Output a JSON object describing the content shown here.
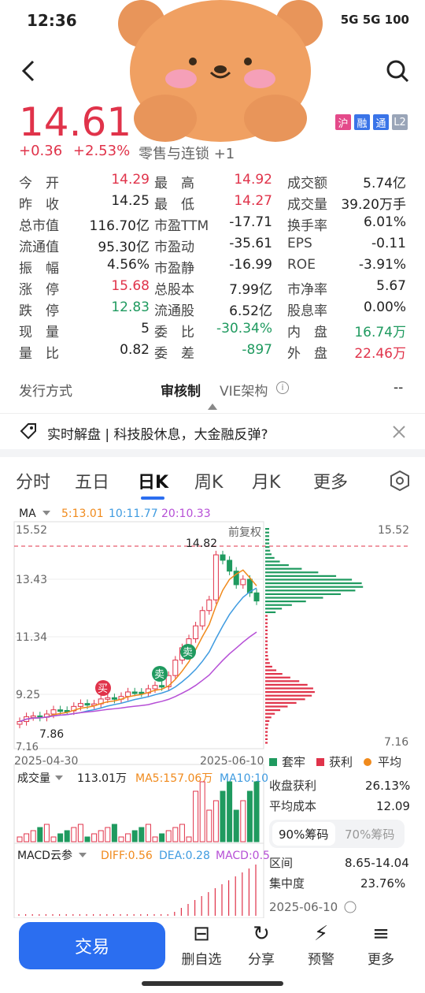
{
  "status_bar": {
    "time": "12:36",
    "signal": "5G 5G 100"
  },
  "header": {
    "back_icon": "chevron-left-icon",
    "search_icon": "search-icon"
  },
  "quote": {
    "price": "14.61",
    "change_abs": "+0.36",
    "change_pct": "+2.53%",
    "sector": "零售与连锁 +1",
    "badges": [
      {
        "label": "沪",
        "color": "#e44a8a"
      },
      {
        "label": "融",
        "color": "#3a74e8"
      },
      {
        "label": "通",
        "color": "#3a74e8"
      },
      {
        "label": "L2",
        "color": "#9aa5b8"
      }
    ]
  },
  "stats": [
    [
      {
        "label": "今　开",
        "value": "14.29",
        "color": "red"
      },
      {
        "label": "最　高",
        "value": "14.92",
        "color": "red"
      },
      {
        "label": "成交额",
        "value": "5.74亿",
        "color": "dark"
      }
    ],
    [
      {
        "label": "昨　收",
        "value": "14.25",
        "color": "dark"
      },
      {
        "label": "最　低",
        "value": "14.27",
        "color": "red"
      },
      {
        "label": "成交量",
        "value": "39.20万手",
        "color": "dark"
      }
    ],
    [
      {
        "label": "总市值",
        "value": "116.70亿",
        "color": "dark"
      },
      {
        "label": "市盈TTM",
        "value": "-17.71",
        "color": "dark"
      },
      {
        "label": "换手率",
        "value": "6.01%",
        "color": "dark"
      }
    ],
    [
      {
        "label": "流通值",
        "value": "95.30亿",
        "color": "dark"
      },
      {
        "label": "市盈动",
        "value": "-35.61",
        "color": "dark"
      },
      {
        "label": "EPS",
        "value": "-0.11",
        "color": "dark"
      }
    ],
    [
      {
        "label": "振　幅",
        "value": "4.56%",
        "color": "dark"
      },
      {
        "label": "市盈静",
        "value": "-16.99",
        "color": "dark"
      },
      {
        "label": "ROE",
        "value": "-3.91%",
        "color": "dark"
      }
    ],
    [
      {
        "label": "涨　停",
        "value": "15.68",
        "color": "red"
      },
      {
        "label": "总股本",
        "value": "7.99亿",
        "color": "dark"
      },
      {
        "label": "市净率",
        "value": "5.67",
        "color": "dark"
      }
    ],
    [
      {
        "label": "跌　停",
        "value": "12.83",
        "color": "green"
      },
      {
        "label": "流通股",
        "value": "6.52亿",
        "color": "dark"
      },
      {
        "label": "股息率",
        "value": "0.00%",
        "color": "dark"
      }
    ],
    [
      {
        "label": "现　量",
        "value": "5",
        "color": "dark"
      },
      {
        "label": "委　比",
        "value": "-30.34%",
        "color": "green"
      },
      {
        "label": "内　盘",
        "value": "16.74万",
        "color": "green"
      }
    ],
    [
      {
        "label": "量　比",
        "value": "0.82",
        "color": "dark"
      },
      {
        "label": "委　差",
        "value": "-897",
        "color": "green"
      },
      {
        "label": "外　盘",
        "value": "22.46万",
        "color": "red"
      }
    ]
  ],
  "issuance": {
    "label": "发行方式",
    "option_a": "审核制",
    "option_b": "VIE架构",
    "value": "--"
  },
  "news": {
    "text": "实时解盘 | 科技股休息，大金融反弹?"
  },
  "tabs": [
    "分时",
    "五日",
    "日K",
    "周K",
    "月K",
    "更多"
  ],
  "active_tab": "日K",
  "chart": {
    "ma_label": "MA",
    "ma5": "5:13.01",
    "ma10": "10:11.77",
    "ma20": "20:10.33",
    "restore_label": "前复权",
    "y_top": "15.52",
    "y_top_right": "15.52",
    "y_2": "13.43",
    "y_3": "11.34",
    "y_4": "9.25",
    "y_bottom": "7.16",
    "y_bottom_right": "7.16",
    "high_marker": "14.82",
    "low_marker": "7.86",
    "date_start": "2025-04-30",
    "date_end": "2025-06-10",
    "buy_tag": "买",
    "sell_tag": "卖",
    "legend": {
      "trapped": "套牢",
      "profit": "获利",
      "avg": "平均"
    },
    "profit_ratio_label": "收盘获利",
    "profit_ratio": "26.13%",
    "avg_cost_label": "平均成本",
    "avg_cost": "12.09",
    "chip90": "90%筹码",
    "chip70": "70%筹码",
    "range_label": "区间",
    "range": "8.65-14.04",
    "concentration_label": "集中度",
    "concentration": "23.76%",
    "chip_date": "2025-06-10",
    "volume_label": "成交量",
    "volume_value": "113.01万",
    "vol_ma5": "MA5:157.06万",
    "vol_ma10": "MA10:10",
    "macd_label": "MACD云参",
    "diff": "DIFF:0.56",
    "dea": "DEA:0.28",
    "macd": "MACD:0.5"
  },
  "bottom": {
    "trade": "交易",
    "actions": [
      {
        "label": "删自选",
        "icon": "minus-square-icon",
        "glyph": "⊟"
      },
      {
        "label": "分享",
        "icon": "share-icon",
        "glyph": "↻"
      },
      {
        "label": "预警",
        "icon": "alert-icon",
        "glyph": "⚡"
      },
      {
        "label": "更多",
        "icon": "more-icon",
        "glyph": "≡"
      }
    ]
  },
  "colors": {
    "up": "#e0334a",
    "down": "#1f9a5f",
    "ma5": "#f08a1c",
    "ma10": "#3f9be0",
    "ma20": "#b64fd6",
    "accent": "#2b6ef0"
  }
}
